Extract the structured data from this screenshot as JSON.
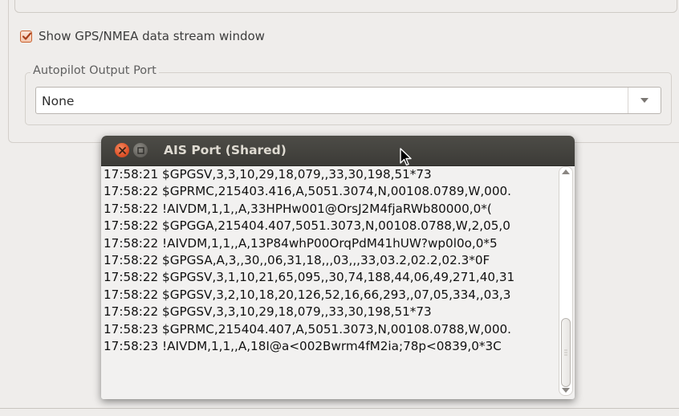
{
  "settings": {
    "show_gps_label": "Show GPS/NMEA data stream window",
    "show_gps_checked": true,
    "autopilot_group_label": "Autopilot Output Port",
    "autopilot_port_value": "None"
  },
  "ais_window": {
    "title": "AIS Port (Shared)",
    "log_lines": [
      "17:58:21  $GPGSV,3,3,10,29,18,079,,33,30,198,51*73",
      "17:58:22  $GPRMC,215403.416,A,5051.3074,N,00108.0789,W,000.",
      "17:58:22  !AIVDM,1,1,,A,33HPHw001@OrsJ2M4fjaRWb80000,0*(",
      "17:58:22  $GPGGA,215404.407,5051.3073,N,00108.0788,W,2,05,0",
      "17:58:22  !AIVDM,1,1,,A,13P84whP00OrqPdM41hUW?wp0l0o,0*5",
      "17:58:22  $GPGSA,A,3,,30,,06,31,18,,,03,,,33,03.2,02.2,02.3*0F",
      "17:58:22  $GPGSV,3,1,10,21,65,095,,30,74,188,44,06,49,271,40,31",
      "17:58:22  $GPGSV,3,2,10,18,20,126,52,16,66,293,,07,05,334,,03,3",
      "17:58:22  $GPGSV,3,3,10,29,18,079,,33,30,198,51*73",
      "17:58:23  $GPRMC,215404.407,A,5051.3073,N,00108.0788,W,000.",
      "17:58:23  !AIVDM,1,1,,A,18I@a<002Bwrm4fM2ia;78p<0839,0*3C"
    ]
  },
  "colors": {
    "accent": "#e0532a",
    "titlebar": "#3c3b37"
  }
}
